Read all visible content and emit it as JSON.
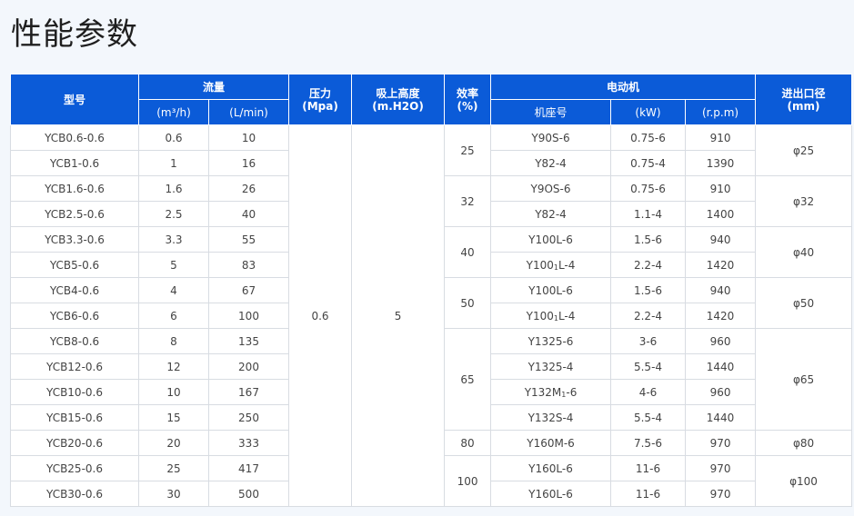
{
  "page": {
    "title": "性能参数"
  },
  "table": {
    "headers": {
      "model": "型号",
      "flow": "流量",
      "flow_m3h": "(m³/h)",
      "flow_lmin": "(L/min)",
      "pressure": "压力",
      "pressure_unit": "(Mpa)",
      "suction": "吸上高度",
      "suction_unit": "(m.H2O)",
      "efficiency": "效率",
      "efficiency_unit": "(%)",
      "motor": "电动机",
      "motor_frame": "机座号",
      "motor_power": "(kW)",
      "motor_speed": "(r.p.m)",
      "port": "进出口径",
      "port_unit": "(mm)"
    },
    "pressure_value": "0.6",
    "suction_value": "5",
    "rows": [
      {
        "model": "YCB0.6-0.6",
        "m3h": "0.6",
        "lmin": "10",
        "frame": "Y90S-6",
        "kw": "0.75-6",
        "rpm": "910"
      },
      {
        "model": "YCB1-0.6",
        "m3h": "1",
        "lmin": "16",
        "frame": "Y82-4",
        "kw": "0.75-4",
        "rpm": "1390"
      },
      {
        "model": "YCB1.6-0.6",
        "m3h": "1.6",
        "lmin": "26",
        "frame": "Y9OS-6",
        "kw": "0.75-6",
        "rpm": "910"
      },
      {
        "model": "YCB2.5-0.6",
        "m3h": "2.5",
        "lmin": "40",
        "frame": "Y82-4",
        "kw": "1.1-4",
        "rpm": "1400"
      },
      {
        "model": "YCB3.3-0.6",
        "m3h": "3.3",
        "lmin": "55",
        "frame": "Y100L-6",
        "kw": "1.5-6",
        "rpm": "940"
      },
      {
        "model": "YCB5-0.6",
        "m3h": "5",
        "lmin": "83",
        "frame_pre": "Y100",
        "frame_sub": "1",
        "frame_post": "L-4",
        "kw": "2.2-4",
        "rpm": "1420"
      },
      {
        "model": "YCB4-0.6",
        "m3h": "4",
        "lmin": "67",
        "frame": "Y100L-6",
        "kw": "1.5-6",
        "rpm": "940"
      },
      {
        "model": "YCB6-0.6",
        "m3h": "6",
        "lmin": "100",
        "frame_pre": "Y100",
        "frame_sub": "1",
        "frame_post": "L-4",
        "kw": "2.2-4",
        "rpm": "1420"
      },
      {
        "model": "YCB8-0.6",
        "m3h": "8",
        "lmin": "135",
        "frame": "Y1325-6",
        "kw": "3-6",
        "rpm": "960"
      },
      {
        "model": "YCB12-0.6",
        "m3h": "12",
        "lmin": "200",
        "frame": "Y1325-4",
        "kw": "5.5-4",
        "rpm": "1440"
      },
      {
        "model": "YCB10-0.6",
        "m3h": "10",
        "lmin": "167",
        "frame_pre": "Y132M",
        "frame_sub": "1",
        "frame_post": "-6",
        "kw": "4-6",
        "rpm": "960"
      },
      {
        "model": "YCB15-0.6",
        "m3h": "15",
        "lmin": "250",
        "frame": "Y132S-4",
        "kw": "5.5-4",
        "rpm": "1440"
      },
      {
        "model": "YCB20-0.6",
        "m3h": "20",
        "lmin": "333",
        "frame": "Y160M-6",
        "kw": "7.5-6",
        "rpm": "970"
      },
      {
        "model": "YCB25-0.6",
        "m3h": "25",
        "lmin": "417",
        "frame": "Y160L-6",
        "kw": "11-6",
        "rpm": "970"
      },
      {
        "model": "YCB30-0.6",
        "m3h": "30",
        "lmin": "500",
        "frame": "Y160L-6",
        "kw": "11-6",
        "rpm": "970"
      }
    ],
    "efficiency_groups": [
      "25",
      "32",
      "40",
      "50",
      "65",
      "80",
      "100"
    ],
    "port_groups": [
      "φ25",
      "φ32",
      "φ40",
      "φ50",
      "φ65",
      "φ80",
      "φ100"
    ]
  }
}
